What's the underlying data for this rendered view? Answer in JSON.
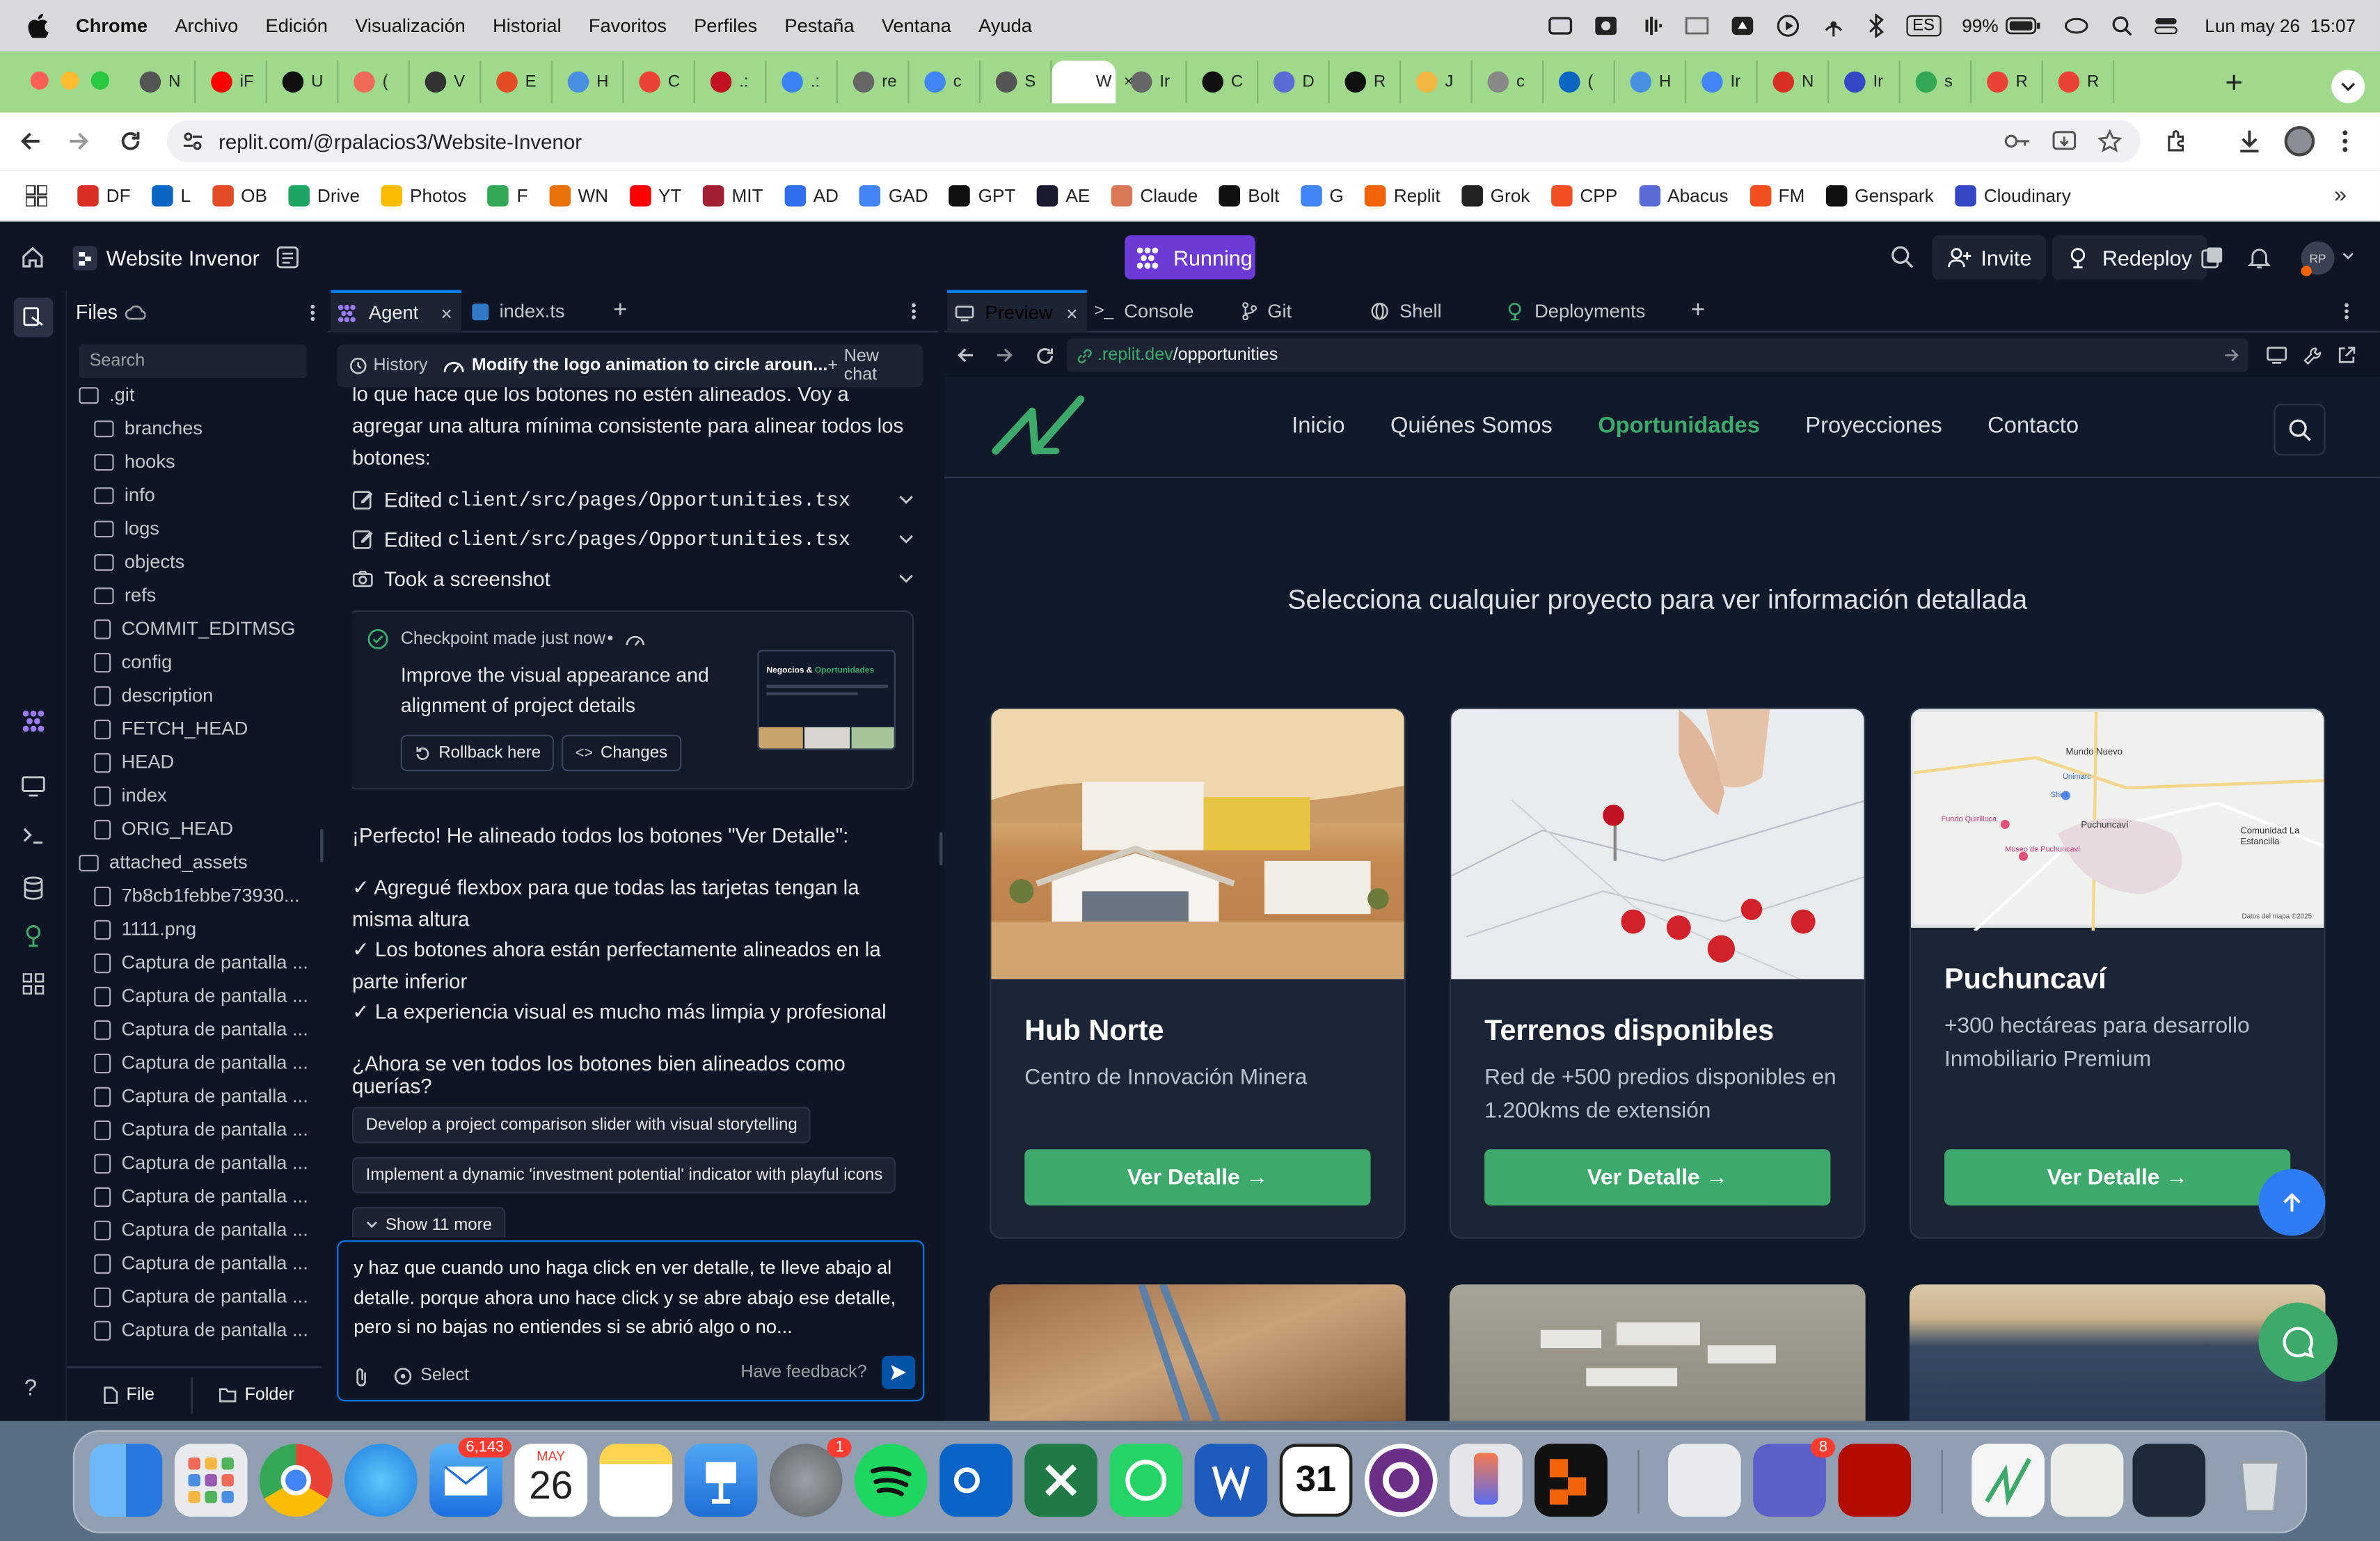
{
  "menubar": {
    "app": "Chrome",
    "items": [
      "Archivo",
      "Edición",
      "Visualización",
      "Historial",
      "Favoritos",
      "Perfiles",
      "Pestaña",
      "Ventana",
      "Ayuda"
    ],
    "lang": "ES",
    "battery": "99%",
    "datetime": "Lun may 26  15:07"
  },
  "tabs": {
    "labels": [
      "N",
      "iF",
      "U",
      "(",
      "V",
      "E",
      "H",
      "C",
      ".:",
      ".:",
      "re",
      "c",
      "S",
      "W",
      "Ir",
      "C",
      "D",
      "R",
      "J",
      "c",
      "(",
      "H",
      "Ir",
      "N",
      "Ir",
      "s",
      "R",
      "R"
    ],
    "active_index": 13,
    "active_close": "×"
  },
  "toolbar": {
    "url": "replit.com/@rpalacios3/Website-Invenor"
  },
  "bookmarks": [
    {
      "label": "DF",
      "color": "#d93025"
    },
    {
      "label": "L",
      "color": "#0a66c2"
    },
    {
      "label": "OB",
      "color": "#e34c26"
    },
    {
      "label": "Drive",
      "color": "#1fa463"
    },
    {
      "label": "Photos",
      "color": "#fbbc04"
    },
    {
      "label": "F",
      "color": "#34a853"
    },
    {
      "label": "WN",
      "color": "#e8710a"
    },
    {
      "label": "YT",
      "color": "#ff0000"
    },
    {
      "label": "MIT",
      "color": "#a31f34"
    },
    {
      "label": "AD",
      "color": "#2f6fed"
    },
    {
      "label": "GAD",
      "color": "#4285f4"
    },
    {
      "label": "GPT",
      "color": "#111111"
    },
    {
      "label": "AE",
      "color": "#1a1a2e"
    },
    {
      "label": "Claude",
      "color": "#d97757"
    },
    {
      "label": "Bolt",
      "color": "#111111"
    },
    {
      "label": "G",
      "color": "#4285f4"
    },
    {
      "label": "Replit",
      "color": "#f26207"
    },
    {
      "label": "Grok",
      "color": "#222222"
    },
    {
      "label": "CPP",
      "color": "#f25022"
    },
    {
      "label": "Abacus",
      "color": "#5b6bd6"
    },
    {
      "label": "FM",
      "color": "#f24e1e"
    },
    {
      "label": "Genspark",
      "color": "#111111"
    },
    {
      "label": "Cloudinary",
      "color": "#3448c5"
    }
  ],
  "replit": {
    "project": "Website Invenor",
    "status": "Running",
    "invite": "Invite",
    "redeploy": "Redeploy",
    "avatar": "RP"
  },
  "files": {
    "title": "Files",
    "search": "Search",
    "items": [
      {
        "name": ".git",
        "type": "folder",
        "level": 0
      },
      {
        "name": "branches",
        "type": "folder",
        "level": 1
      },
      {
        "name": "hooks",
        "type": "folder",
        "level": 1
      },
      {
        "name": "info",
        "type": "folder",
        "level": 1
      },
      {
        "name": "logs",
        "type": "folder",
        "level": 1
      },
      {
        "name": "objects",
        "type": "folder",
        "level": 1
      },
      {
        "name": "refs",
        "type": "folder",
        "level": 1
      },
      {
        "name": "COMMIT_EDITMSG",
        "type": "file",
        "level": 1
      },
      {
        "name": "config",
        "type": "file",
        "level": 1
      },
      {
        "name": "description",
        "type": "file",
        "level": 1
      },
      {
        "name": "FETCH_HEAD",
        "type": "file",
        "level": 1
      },
      {
        "name": "HEAD",
        "type": "file",
        "level": 1
      },
      {
        "name": "index",
        "type": "file",
        "level": 1
      },
      {
        "name": "ORIG_HEAD",
        "type": "file",
        "level": 1
      },
      {
        "name": "attached_assets",
        "type": "folder",
        "level": 0
      },
      {
        "name": "7b8cb1febbe73930...",
        "type": "image",
        "level": 1
      },
      {
        "name": "1111.png",
        "type": "image",
        "level": 1
      },
      {
        "name": "Captura de pantalla ...",
        "type": "image",
        "level": 1
      },
      {
        "name": "Captura de pantalla ...",
        "type": "image",
        "level": 1
      },
      {
        "name": "Captura de pantalla ...",
        "type": "image",
        "level": 1
      },
      {
        "name": "Captura de pantalla ...",
        "type": "image",
        "level": 1
      },
      {
        "name": "Captura de pantalla ...",
        "type": "image",
        "level": 1
      },
      {
        "name": "Captura de pantalla ...",
        "type": "image",
        "level": 1
      },
      {
        "name": "Captura de pantalla ...",
        "type": "image",
        "level": 1
      },
      {
        "name": "Captura de pantalla ...",
        "type": "image",
        "level": 1
      },
      {
        "name": "Captura de pantalla ...",
        "type": "image",
        "level": 1
      },
      {
        "name": "Captura de pantalla ...",
        "type": "image",
        "level": 1
      },
      {
        "name": "Captura de pantalla ...",
        "type": "image",
        "level": 1
      },
      {
        "name": "Captura de pantalla ...",
        "type": "image",
        "level": 1
      }
    ],
    "file_btn": "File",
    "folder_btn": "Folder"
  },
  "agent": {
    "tab_label": "Agent",
    "tab2_label": "index.ts",
    "history": "History",
    "thread_title": "Modify the logo animation to circle aroun...",
    "new_chat": "New chat",
    "intro": "lo que hace que los botones no estén alineados. Voy a agregar una altura mínima consistente para alinear todos los botones:",
    "actions": [
      {
        "prefix": "Edited ",
        "file": "client/src/pages/Opportunities.tsx"
      },
      {
        "prefix": "Edited ",
        "file": "client/src/pages/Opportunities.tsx"
      },
      {
        "prefix": "Took a screenshot",
        "file": ""
      }
    ],
    "checkpoint": {
      "meta": "Checkpoint made just now",
      "dot": "•",
      "desc": "Improve the visual appearance and alignment of project details",
      "rollback": "Rollback here",
      "changes": "Changes",
      "thumb_title_a": "Negocios & ",
      "thumb_title_b": "Oportunidades"
    },
    "reply_title": "¡Perfecto! He alineado todos los botones \"Ver Detalle\":",
    "bullets": [
      "✓ Agregué flexbox para que todas las tarjetas tengan la misma altura",
      "✓ Los botones ahora están perfectamente alineados en la parte inferior",
      "✓ La experiencia visual es mucho más limpia y profesional"
    ],
    "question": "¿Ahora se ven todos los botones bien alineados como querías?",
    "suggestions": [
      "Develop a project comparison slider with visual storytelling",
      "Implement a dynamic 'investment potential' indicator with playful icons"
    ],
    "show_more": "Show 11 more",
    "input_text": "y haz que cuando uno haga click en ver detalle, te lleve abajo al detalle. porque ahora uno hace click y se abre abajo ese detalle, pero si no bajas no entiendes si se abrió algo o no...",
    "select": "Select",
    "feedback": "Have feedback?"
  },
  "preview": {
    "tabs": [
      "Preview",
      "Console",
      "Git",
      "Shell",
      "Deployments"
    ],
    "url_host": ".replit.dev",
    "url_path": "/opportunities",
    "nav": [
      "Inicio",
      "Quiénes Somos",
      "Oportunidades",
      "Proyecciones",
      "Contacto"
    ],
    "active_nav": 2,
    "subtitle": "Selecciona cualquier proyecto para ver información detallada",
    "cards": [
      {
        "title": "Hub Norte",
        "desc": "Centro de Innovación Minera",
        "button": "Ver Detalle →"
      },
      {
        "title": "Terrenos disponibles",
        "desc": "Red de +500 predios disponibles en 1.200kms de extensión",
        "button": "Ver Detalle →"
      },
      {
        "title": "Puchuncaví",
        "desc": "+300 hectáreas para desarrollo Inmobiliario Premium",
        "button": "Ver Detalle →"
      }
    ],
    "map_labels": [
      "Mundo Nuevo",
      "Puchuncaví",
      "Comunidad La Estancilla",
      "Fundo Quirilluca",
      "Museo de Puchuncaví",
      "Shell",
      "Unimarc",
      "Datos del mapa ©2025"
    ],
    "accent": "#3daa6b"
  },
  "dock": {
    "mail_badge": "6,143",
    "calendar_month": "MAY",
    "calendar_day": "26",
    "settings_badge": "1",
    "teams_badge": "8",
    "cal31": "31"
  }
}
